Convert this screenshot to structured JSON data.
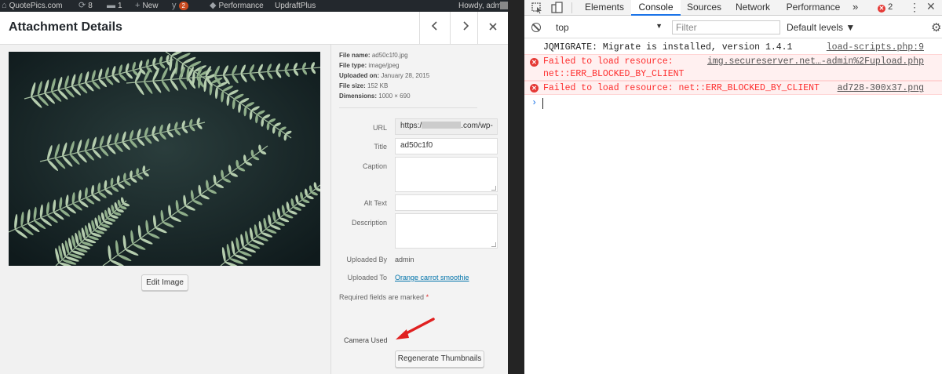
{
  "admin_bar": {
    "site_name": "QuotePics.com",
    "updates_count": "8",
    "comments_count": "1",
    "new_label": "New",
    "yoast_badge": "2",
    "performance_label": "Performance",
    "updraft_label": "UpdraftPlus",
    "greeting": "Howdy, admin"
  },
  "modal": {
    "title": "Attachment Details",
    "prev_icon": "chevron-left-icon",
    "next_icon": "chevron-right-icon",
    "close_icon": "close-icon",
    "edit_image_label": "Edit Image"
  },
  "details": {
    "file_name_label": "File name:",
    "file_name": "ad50c1f0.jpg",
    "file_type_label": "File type:",
    "file_type": "image/jpeg",
    "uploaded_on_label": "Uploaded on:",
    "uploaded_on": "January 28, 2015",
    "file_size_label": "File size:",
    "file_size": "152 KB",
    "dimensions_label": "Dimensions:",
    "dimensions": "1000 × 690"
  },
  "fields": {
    "url_label": "URL",
    "url_prefix": "https:/",
    "url_suffix": ".com/wp-",
    "title_label": "Title",
    "title_value": "ad50c1f0",
    "caption_label": "Caption",
    "caption_value": "",
    "alt_label": "Alt Text",
    "alt_value": "",
    "description_label": "Description",
    "description_value": "",
    "uploaded_by_label": "Uploaded By",
    "uploaded_by": "admin",
    "uploaded_to_label": "Uploaded To",
    "uploaded_to": "Orange carrot smoothie",
    "required_note": "Required fields are marked",
    "required_star": "*",
    "camera_label": "Camera Used",
    "regenerate_label": "Regenerate Thumbnails"
  },
  "devtools": {
    "tabs": [
      "Elements",
      "Console",
      "Sources",
      "Network",
      "Performance"
    ],
    "active_tab": "Console",
    "more_tabs": "»",
    "error_count": "2",
    "context": "top",
    "filter_placeholder": "Filter",
    "levels_label": "Default levels ▼",
    "messages": [
      {
        "level": "info",
        "text": "JQMIGRATE: Migrate is installed, version 1.4.1",
        "source": "load-scripts.php:9"
      },
      {
        "level": "error",
        "text": "Failed to load resource:",
        "text2": "net::ERR_BLOCKED_BY_CLIENT",
        "source": "img.secureserver.net…-admin%2Fupload.php"
      },
      {
        "level": "error",
        "text": "Failed to load resource: net::ERR_BLOCKED_BY_CLIENT",
        "source": "ad728-300x37.png"
      }
    ],
    "prompt_symbol": "›"
  },
  "colors": {
    "wp_admin_bar": "#23282d",
    "wp_link": "#0073aa",
    "devtools_error": "#fe2c2c",
    "devtools_accent": "#1a73e8",
    "arrow": "#e02020"
  }
}
